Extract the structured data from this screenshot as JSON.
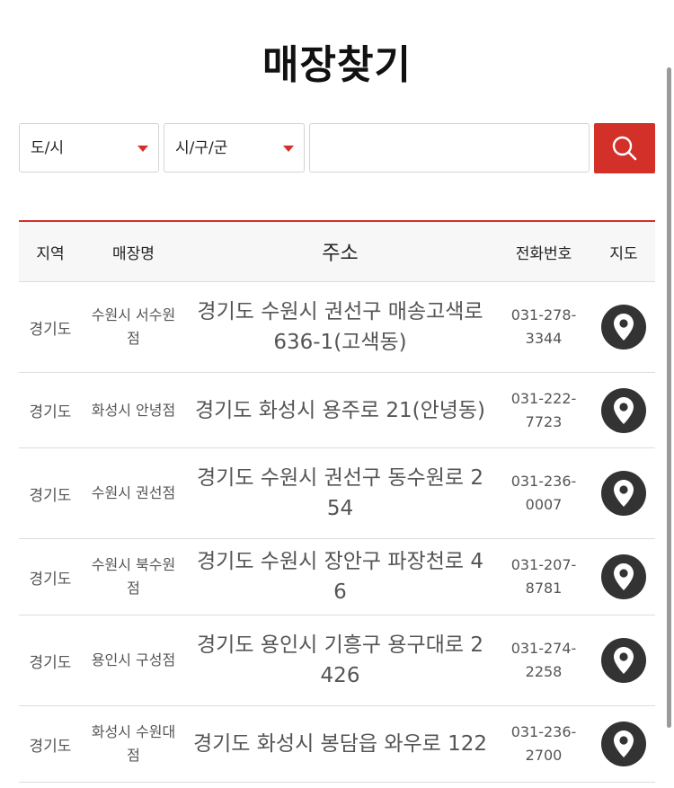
{
  "title": "매장찾기",
  "search": {
    "city_label": "도/시",
    "district_label": "시/구/군",
    "query_value": "",
    "query_placeholder": "",
    "button_icon": "search-icon",
    "accent_color": "#d4302a"
  },
  "table": {
    "headers": {
      "region": "지역",
      "name": "매장명",
      "address": "주소",
      "phone": "전화번호",
      "map": "지도"
    },
    "map_icon": "location-pin-icon",
    "rows": [
      {
        "region": "경기도",
        "name": "수원시 서수원점",
        "address": "경기도 수원시 권선구 매송고색로 636-1(고색동)",
        "phone": "031-278-3344"
      },
      {
        "region": "경기도",
        "name": "화성시 안녕점",
        "address": "경기도 화성시 용주로 21(안녕동)",
        "phone": "031-222-7723"
      },
      {
        "region": "경기도",
        "name": "수원시 권선점",
        "address": "경기도 수원시 권선구 동수원로 254",
        "phone": "031-236-0007"
      },
      {
        "region": "경기도",
        "name": "수원시 북수원점",
        "address": "경기도 수원시 장안구 파장천로 46",
        "phone": "031-207-8781"
      },
      {
        "region": "경기도",
        "name": "용인시 구성점",
        "address": "경기도 용인시 기흥구 용구대로 2426",
        "phone": "031-274-2258"
      },
      {
        "region": "경기도",
        "name": "화성시 수원대점",
        "address": "경기도 화성시 봉담읍 와우로 122",
        "phone": "031-236-2700"
      }
    ]
  }
}
